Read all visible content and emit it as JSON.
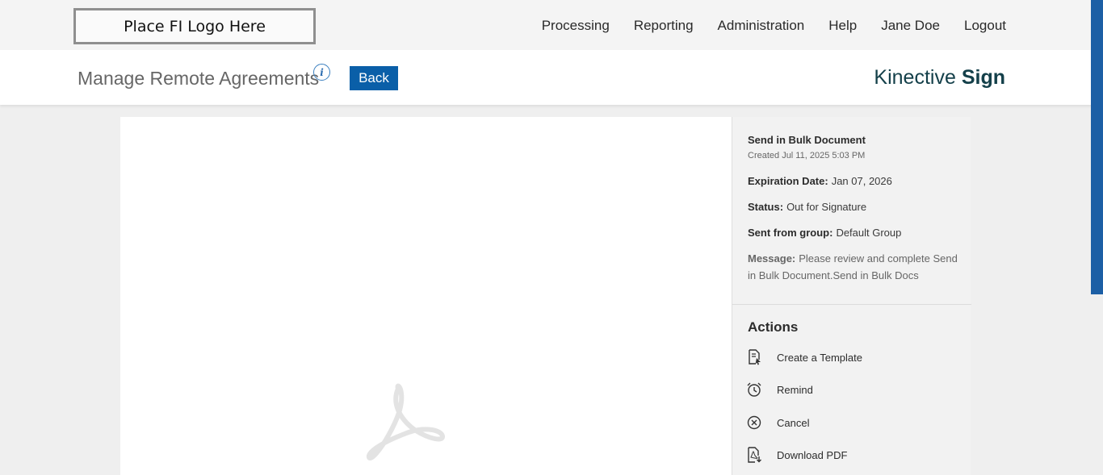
{
  "header": {
    "logo_text": "Place FI Logo Here",
    "nav": [
      "Processing",
      "Reporting",
      "Administration",
      "Help",
      "Jane Doe",
      "Logout"
    ]
  },
  "subheader": {
    "title": "Manage Remote Agreements",
    "info_icon": "info-icon",
    "back_label": "Back",
    "brand_light": "Kinective",
    "brand_bold": "Sign"
  },
  "viewer": {
    "placeholder_icon": "acrobat-pdf-icon"
  },
  "panel": {
    "doc_title": "Send in Bulk Document",
    "created": "Created Jul 11, 2025 5:03 PM",
    "expiration_label": "Expiration Date:",
    "expiration_value": "Jan 07, 2026",
    "status_label": "Status:",
    "status_value": "Out for Signature",
    "group_label": "Sent from group:",
    "group_value": "Default Group",
    "message_label": "Message:",
    "message_value": "Please review and complete Send in Bulk Document.Send in Bulk Docs",
    "actions_heading": "Actions",
    "actions": [
      {
        "label": "Create a Template",
        "icon": "template-icon"
      },
      {
        "label": "Remind",
        "icon": "alarm-clock-icon"
      },
      {
        "label": "Cancel",
        "icon": "cancel-circle-icon"
      },
      {
        "label": "Download PDF",
        "icon": "download-pdf-icon"
      }
    ]
  },
  "colors": {
    "accent": "#0a5fa8",
    "brand": "#14404a",
    "scroll_accent": "#1c5fa5"
  }
}
